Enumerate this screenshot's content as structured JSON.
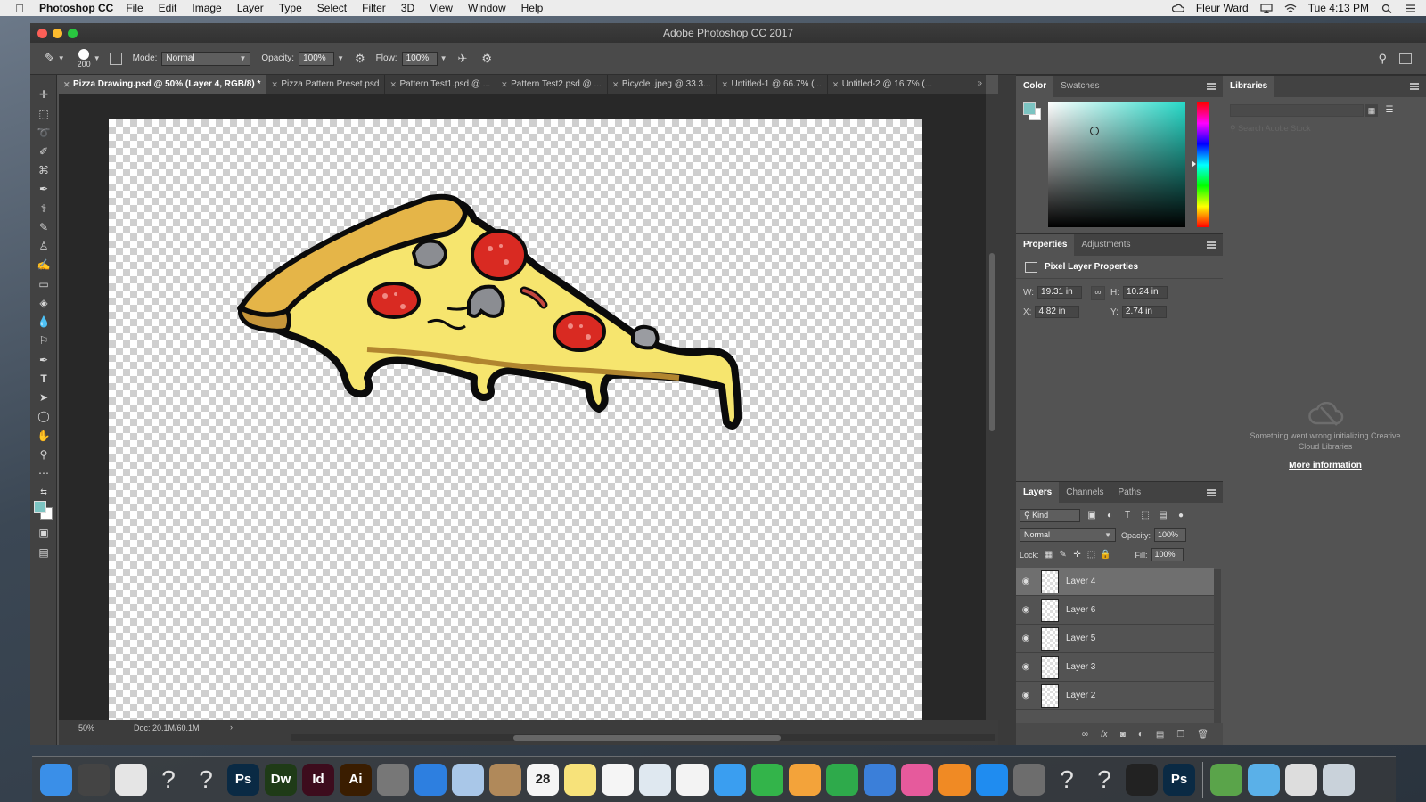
{
  "menubar": {
    "app_name": "Photoshop CC",
    "items": [
      "File",
      "Edit",
      "Image",
      "Layer",
      "Type",
      "Select",
      "Filter",
      "3D",
      "View",
      "Window",
      "Help"
    ],
    "user": "Fleur Ward",
    "clock": "Tue 4:13 PM"
  },
  "window": {
    "title": "Adobe Photoshop CC 2017"
  },
  "options": {
    "brush_size": "200",
    "mode_label": "Mode:",
    "mode_value": "Normal",
    "opacity_label": "Opacity:",
    "opacity_value": "100%",
    "flow_label": "Flow:",
    "flow_value": "100%"
  },
  "tabs": [
    {
      "label": "Pizza Drawing.psd @ 50% (Layer 4, RGB/8) *",
      "active": true
    },
    {
      "label": "Pizza Pattern Preset.psd"
    },
    {
      "label": "Pattern Test1.psd @ ..."
    },
    {
      "label": "Pattern Test2.psd @ ..."
    },
    {
      "label": "Bicycle .jpeg @ 33.3..."
    },
    {
      "label": "Untitled-1 @ 66.7% (..."
    },
    {
      "label": "Untitled-2 @ 16.7% (..."
    }
  ],
  "status": {
    "zoom": "50%",
    "doc": "Doc: 20.1M/60.1M",
    "arrow": "›"
  },
  "color_panel": {
    "tabs": [
      "Color",
      "Swatches"
    ],
    "foreground": "#7cc4c2",
    "hue_color": "#27d9c8"
  },
  "properties_panel": {
    "tabs": [
      "Properties",
      "Adjustments"
    ],
    "header": "Pixel Layer Properties",
    "w_label": "W:",
    "w_value": "19.31 in",
    "h_label": "H:",
    "h_value": "10.24 in",
    "x_label": "X:",
    "x_value": "4.82 in",
    "y_label": "Y:",
    "y_value": "2.74 in"
  },
  "layers_panel": {
    "tabs": [
      "Layers",
      "Channels",
      "Paths"
    ],
    "filter": "Kind",
    "blend_mode": "Normal",
    "opacity_label": "Opacity:",
    "opacity_value": "100%",
    "lock_label": "Lock:",
    "fill_label": "Fill:",
    "fill_value": "100%",
    "layers": [
      {
        "name": "Layer 4",
        "selected": true
      },
      {
        "name": "Layer 6"
      },
      {
        "name": "Layer 5"
      },
      {
        "name": "Layer 3"
      },
      {
        "name": "Layer 2"
      }
    ]
  },
  "libraries_panel": {
    "title": "Libraries",
    "search_placeholder": "Search Adobe Stock",
    "error_message": "Something went wrong initializing Creative Cloud Libraries",
    "more_link": "More information"
  },
  "dock": {
    "apps": [
      {
        "name": "finder-icon",
        "label": "",
        "color": "#3a8fe8"
      },
      {
        "name": "final-cut-icon",
        "label": "",
        "color": "#444"
      },
      {
        "name": "chrome-icon",
        "label": "",
        "color": "#e5e5e5"
      },
      {
        "name": "unknown-app-icon",
        "label": "?",
        "color": "transparent"
      },
      {
        "name": "unknown-app-icon",
        "label": "?",
        "color": "transparent"
      },
      {
        "name": "photoshop-icon",
        "label": "Ps",
        "color": "#0a2a44"
      },
      {
        "name": "dreamweaver-icon",
        "label": "Dw",
        "color": "#1f3b17"
      },
      {
        "name": "indesign-icon",
        "label": "Id",
        "color": "#3d0c1d"
      },
      {
        "name": "illustrator-icon",
        "label": "Ai",
        "color": "#3a1d00"
      },
      {
        "name": "launchpad-icon",
        "label": "",
        "color": "#777"
      },
      {
        "name": "safari-icon",
        "label": "",
        "color": "#2d7fe0"
      },
      {
        "name": "mail-icon",
        "label": "",
        "color": "#a9c7e8"
      },
      {
        "name": "contacts-icon",
        "label": "",
        "color": "#b0895a"
      },
      {
        "name": "calendar-icon",
        "label": "28",
        "color": "#f5f5f5"
      },
      {
        "name": "notes-icon",
        "label": "",
        "color": "#f7e27a"
      },
      {
        "name": "reminders-icon",
        "label": "",
        "color": "#f5f5f5"
      },
      {
        "name": "preview-icon",
        "label": "",
        "color": "#dfe8f0"
      },
      {
        "name": "photos-icon",
        "label": "",
        "color": "#f3f3f3"
      },
      {
        "name": "messages-icon",
        "label": "",
        "color": "#3a9ef0"
      },
      {
        "name": "facetime-icon",
        "label": "",
        "color": "#33b44a"
      },
      {
        "name": "pages-icon",
        "label": "",
        "color": "#f3a33a"
      },
      {
        "name": "numbers-icon",
        "label": "",
        "color": "#2eaa4b"
      },
      {
        "name": "keynote-icon",
        "label": "",
        "color": "#3b7fd9"
      },
      {
        "name": "itunes-icon",
        "label": "",
        "color": "#e65a9c"
      },
      {
        "name": "ibooks-icon",
        "label": "",
        "color": "#f08a24"
      },
      {
        "name": "app-store-icon",
        "label": "",
        "color": "#1f8cf0"
      },
      {
        "name": "system-preferences-icon",
        "label": "",
        "color": "#6d6d6d"
      },
      {
        "name": "unknown-app-icon",
        "label": "?",
        "color": "transparent"
      },
      {
        "name": "unknown-app-icon",
        "label": "?",
        "color": "transparent"
      },
      {
        "name": "screen-recorder-icon",
        "label": "",
        "color": "#222"
      },
      {
        "name": "photoshop-icon",
        "label": "Ps",
        "color": "#0a2a44"
      }
    ],
    "right": [
      {
        "name": "preview-frog-icon",
        "color": "#5aa44a"
      },
      {
        "name": "downloads-folder-icon",
        "color": "#5ab0e8"
      },
      {
        "name": "screenshot-stack-icon",
        "color": "#dddddd"
      },
      {
        "name": "trash-icon",
        "color": "#c9d2da"
      }
    ]
  }
}
